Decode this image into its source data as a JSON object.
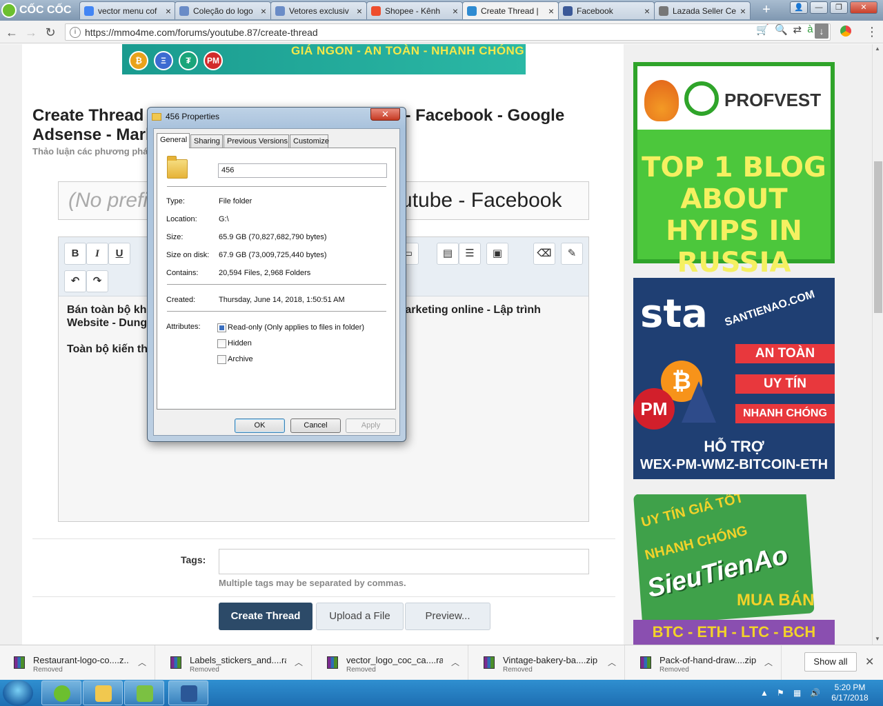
{
  "browser": {
    "brand": "CỐC CỐC",
    "tabs": [
      {
        "label": "vector menu cof",
        "icon": "google-icon",
        "color": "#4285f4"
      },
      {
        "label": "Coleção do logo",
        "icon": "image-icon",
        "color": "#6a8cc7"
      },
      {
        "label": "Vetores exclusiv",
        "icon": "image-icon",
        "color": "#6a8cc7"
      },
      {
        "label": "Shopee - Kênh",
        "icon": "shopee-icon",
        "color": "#ee4d2d"
      },
      {
        "label": "Create Thread |",
        "icon": "mmo-icon",
        "color": "#2f8bd1"
      },
      {
        "label": "Facebook",
        "icon": "facebook-icon",
        "color": "#3b5998"
      },
      {
        "label": "Lazada Seller Ce",
        "icon": "globe-icon",
        "color": "#777777"
      }
    ],
    "tab_close": "×",
    "new_tab": "+",
    "url": "https://mmo4me.com/forums/youtube.87/create-thread"
  },
  "page": {
    "banner_text": "GIÁ NGON - AN TOÀN - NHANH CHÓNG",
    "banner_coins": [
      "₿",
      "Ξ",
      "₮",
      "PM"
    ],
    "title": "Create Thread - Bán toàn bộ khóa học Youtube - Facebook - Google Adsense - Marketing online - Lập trình Website",
    "subtitle": "Thảo luận các phương pháp kiếm tiền từ Youtube",
    "title_input": {
      "prefix": "(No prefix)",
      "value": "Bán toàn bộ khóa học Youtube - Facebook"
    },
    "editor": {
      "toolbar_buttons": [
        "B",
        "I",
        "U"
      ],
      "undo": "↶",
      "redo": "↷",
      "line1": "Bán toàn bộ khóa học Youtube - Facebook - Google Adsense - Marketing online - Lập trình Website - Dung lượng 65.9 GB",
      "line2": "Toàn bộ kiến thức từ cơ bản đến nâng cao"
    },
    "tags_label": "Tags:",
    "tags_hint": "Multiple tags may be separated by commas.",
    "buttons": {
      "create": "Create Thread",
      "upload": "Upload a File",
      "preview": "Preview..."
    }
  },
  "ads": {
    "profvest": {
      "name": "PROFVEST",
      "text": "TOP 1 BLOG ABOUT HYIPS IN RUSSIA"
    },
    "santienao": {
      "logo": "sta",
      "domain": "SANTIENAO.COM",
      "rows": [
        "AN TOÀN",
        "UY TÍN",
        "NHANH CHÓNG"
      ],
      "pm": "PM",
      "btc": "₿",
      "support": "HỖ TRỢ",
      "coins": "WEX-PM-WMZ-BITCOIN-ETH"
    },
    "sieutienao": {
      "line1": "UY TÍN  GIÁ TỐT",
      "line2": "NHANH CHÓNG",
      "logo": "SieuTienAo",
      "buy": "MUA BÁN",
      "coins": "BTC - ETH - LTC - BCH"
    }
  },
  "dialog": {
    "title": "456 Properties",
    "close": "✕",
    "tabs": [
      "General",
      "Sharing",
      "Previous Versions",
      "Customize"
    ],
    "name": "456",
    "props": [
      {
        "label": "Type:",
        "value": "File folder"
      },
      {
        "label": "Location:",
        "value": "G:\\"
      },
      {
        "label": "Size:",
        "value": "65.9 GB (70,827,682,790 bytes)"
      },
      {
        "label": "Size on disk:",
        "value": "67.9 GB (73,009,725,440 bytes)"
      },
      {
        "label": "Contains:",
        "value": "20,594 Files, 2,968 Folders"
      },
      {
        "label": "Created:",
        "value": "Thursday, June 14, 2018, 1:50:51 AM"
      }
    ],
    "attributes_label": "Attributes:",
    "attributes": [
      {
        "label": "Read-only (Only applies to files in folder)",
        "state": "indeterminate"
      },
      {
        "label": "Hidden",
        "state": "unchecked"
      },
      {
        "label": "Archive",
        "state": "unchecked"
      }
    ],
    "buttons": {
      "ok": "OK",
      "cancel": "Cancel",
      "apply": "Apply"
    }
  },
  "downloads": {
    "items": [
      {
        "name": "Restaurant-logo-co....z...",
        "status": "Removed"
      },
      {
        "name": "Labels_stickers_and....rar",
        "status": "Removed"
      },
      {
        "name": "vector_logo_coc_ca....rar",
        "status": "Removed"
      },
      {
        "name": "Vintage-bakery-ba....zip",
        "status": "Removed"
      },
      {
        "name": "Pack-of-hand-draw....zip",
        "status": "Removed"
      }
    ],
    "show_all": "Show all",
    "close": "✕"
  },
  "taskbar": {
    "time": "5:20 PM",
    "date": "6/17/2018"
  }
}
